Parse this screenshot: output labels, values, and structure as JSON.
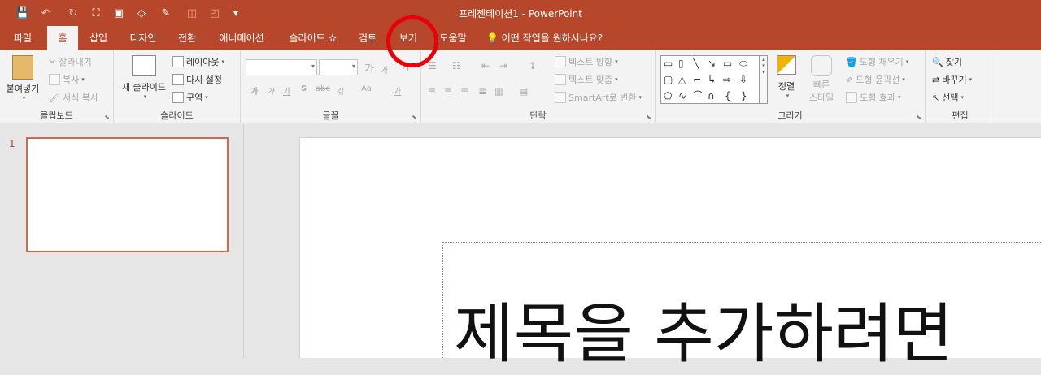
{
  "window": {
    "title": "프레젠테이션1  -  PowerPoint"
  },
  "qat": {
    "save": "💾",
    "undo": "↶",
    "redo": "↻",
    "more": "▾"
  },
  "tabs": [
    "파일",
    "홈",
    "삽입",
    "디자인",
    "전환",
    "애니메이션",
    "슬라이드 쇼",
    "검토",
    "보기",
    "도움말"
  ],
  "tellme": "어떤 작업을 원하시나요?",
  "ribbon": {
    "clipboard": {
      "paste": "붙여넣기",
      "cut": "잘라내기",
      "copy": "복사",
      "format_painter": "서식 복사",
      "label": "클립보드"
    },
    "slides": {
      "new_slide": "새 슬라이드",
      "layout": "레이아웃",
      "reset": "다시 설정",
      "section": "구역",
      "label": "슬라이드"
    },
    "font": {
      "label": "글꼴",
      "grow": "가",
      "shrink": "가",
      "clear": "가",
      "bold": "가",
      "italic": "가",
      "underline": "가",
      "strike": "S",
      "shadow": "abc",
      "spacing": "갂",
      "case": "Aa",
      "color": "가"
    },
    "paragraph": {
      "label": "단락",
      "text_direction": "텍스트 방향",
      "align_text": "텍스트 맞춤",
      "smartart": "SmartArt로 변환"
    },
    "drawing": {
      "label": "그리기",
      "arrange": "정렬",
      "quick_styles_1": "빠른",
      "quick_styles_2": "스타일",
      "fill": "도형 채우기",
      "outline": "도형 윤곽선",
      "effects": "도형 효과"
    },
    "editing": {
      "label": "편집",
      "find": "찾기",
      "replace": "바꾸기",
      "select": "선택"
    }
  },
  "thumbs": {
    "number": "1"
  },
  "slide": {
    "title_placeholder": "제목을 추가하려면"
  }
}
